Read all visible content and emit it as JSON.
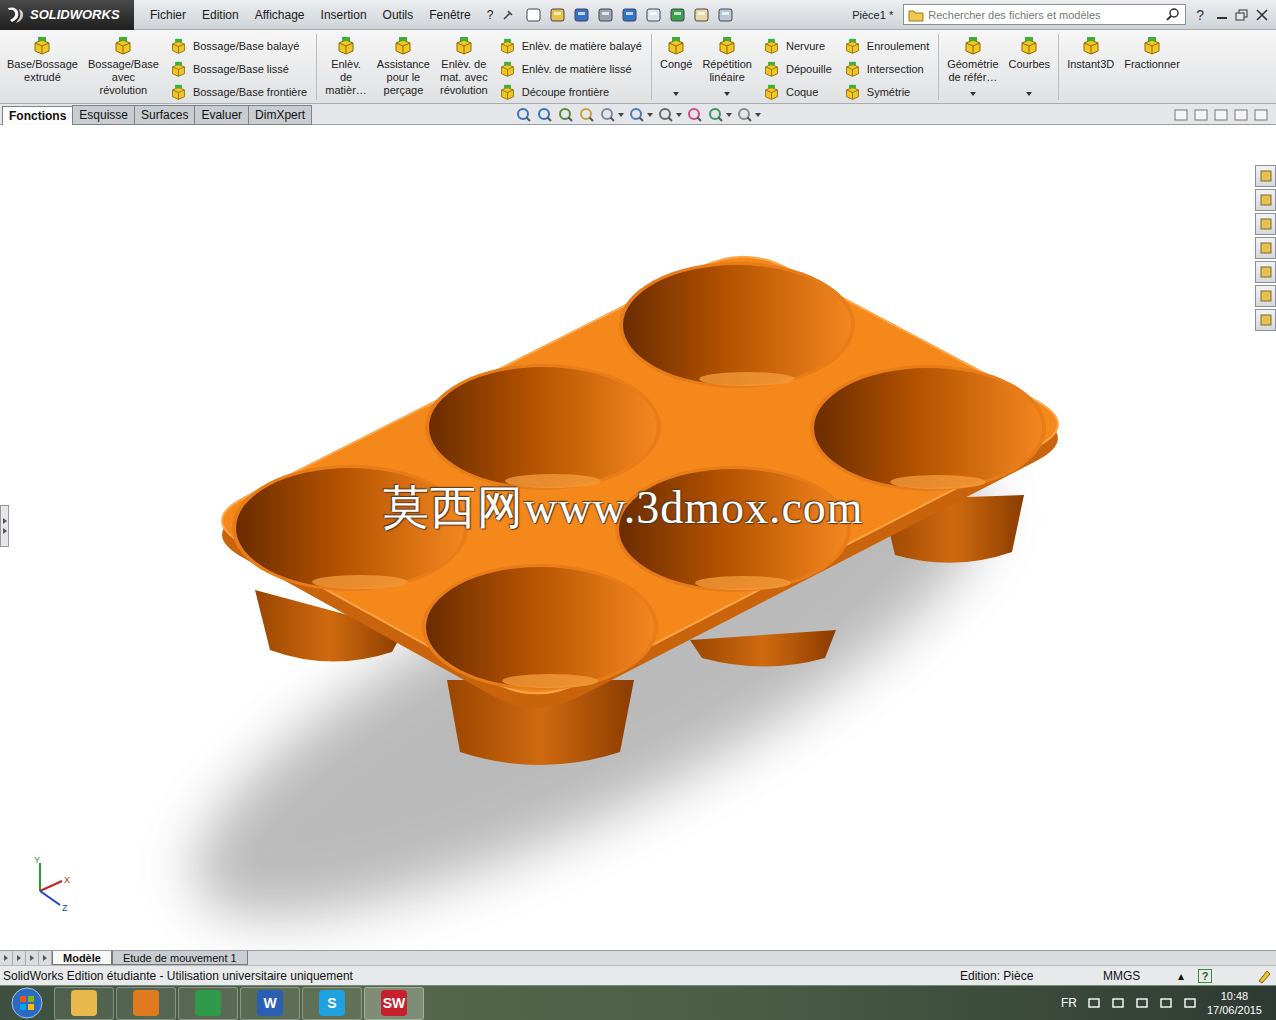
{
  "window": {
    "brand": "SOLIDWORKS",
    "document_title": "Pièce1 *"
  },
  "menu": [
    "Fichier",
    "Edition",
    "Affichage",
    "Insertion",
    "Outils",
    "Fenêtre",
    "?"
  ],
  "search": {
    "placeholder": "Rechercher des fichiers et modèles"
  },
  "help": "?",
  "ribbon": [
    {
      "items": [
        {
          "kind": "large",
          "lines": [
            "Base/Bossage",
            "extrudé"
          ],
          "dropdown": false
        },
        {
          "kind": "large",
          "lines": [
            "Bossage/Base",
            "avec",
            "révolution"
          ],
          "dropdown": false
        },
        {
          "kind": "column",
          "entries": [
            "Bossage/Base balayé",
            "Bossage/Base lissé",
            "Bossage/Base frontière"
          ]
        }
      ]
    },
    {
      "items": [
        {
          "kind": "large",
          "lines": [
            "Enlèv.",
            "de",
            "matièr…"
          ],
          "dropdown": false
        },
        {
          "kind": "large",
          "lines": [
            "Assistance",
            "pour le",
            "perçage"
          ],
          "dropdown": false
        },
        {
          "kind": "large",
          "lines": [
            "Enlèv. de",
            "mat. avec",
            "révolution"
          ],
          "dropdown": false
        },
        {
          "kind": "column",
          "entries": [
            "Enlèv. de matière balayé",
            "Enlèv. de matière lissé",
            "Découpe frontière"
          ]
        }
      ]
    },
    {
      "items": [
        {
          "kind": "large",
          "lines": [
            "Congé"
          ],
          "dropdown": true
        },
        {
          "kind": "large",
          "lines": [
            "Répétition",
            "linéaire"
          ],
          "dropdown": true
        },
        {
          "kind": "column",
          "entries": [
            "Nervure",
            "Dépouille",
            "Coque"
          ]
        },
        {
          "kind": "column",
          "entries": [
            "Enroulement",
            "Intersection",
            "Symétrie"
          ]
        }
      ]
    },
    {
      "items": [
        {
          "kind": "large",
          "lines": [
            "Géométrie",
            "de référ…"
          ],
          "dropdown": true
        },
        {
          "kind": "large",
          "lines": [
            "Courbes"
          ],
          "dropdown": true
        }
      ]
    },
    {
      "items": [
        {
          "kind": "large",
          "lines": [
            "Instant3D"
          ],
          "dropdown": false
        },
        {
          "kind": "large",
          "lines": [
            "Fractionner"
          ],
          "dropdown": false
        }
      ]
    }
  ],
  "tabs": [
    {
      "label": "Fonctions",
      "selected": true
    },
    {
      "label": "Esquisse",
      "selected": false
    },
    {
      "label": "Surfaces",
      "selected": false
    },
    {
      "label": "Evaluer",
      "selected": false
    },
    {
      "label": "DimXpert",
      "selected": false
    }
  ],
  "viewport": {
    "watermark": "莫西网www.3dmox.com",
    "axes": [
      "Y",
      "X",
      "Z"
    ]
  },
  "bottom_tabs": [
    {
      "label": "Modèle",
      "selected": true
    },
    {
      "label": "Etude de mouvement 1",
      "selected": false
    }
  ],
  "status_bar": {
    "message": "SolidWorks Edition étudiante - Utilisation universitaire uniquement",
    "mode": "Edition: Pièce",
    "units": "MMGS",
    "units_arrow": "▴",
    "help": "?"
  },
  "taskbar": {
    "apps": [
      {
        "name": "explorer",
        "glyph": ""
      },
      {
        "name": "media-player",
        "glyph": ""
      },
      {
        "name": "chrome",
        "glyph": ""
      },
      {
        "name": "word",
        "glyph": "W"
      },
      {
        "name": "skype",
        "glyph": "S"
      },
      {
        "name": "solidworks",
        "glyph": "SW"
      }
    ],
    "language": "FR",
    "time": "10:48",
    "date": "17/06/2015"
  }
}
